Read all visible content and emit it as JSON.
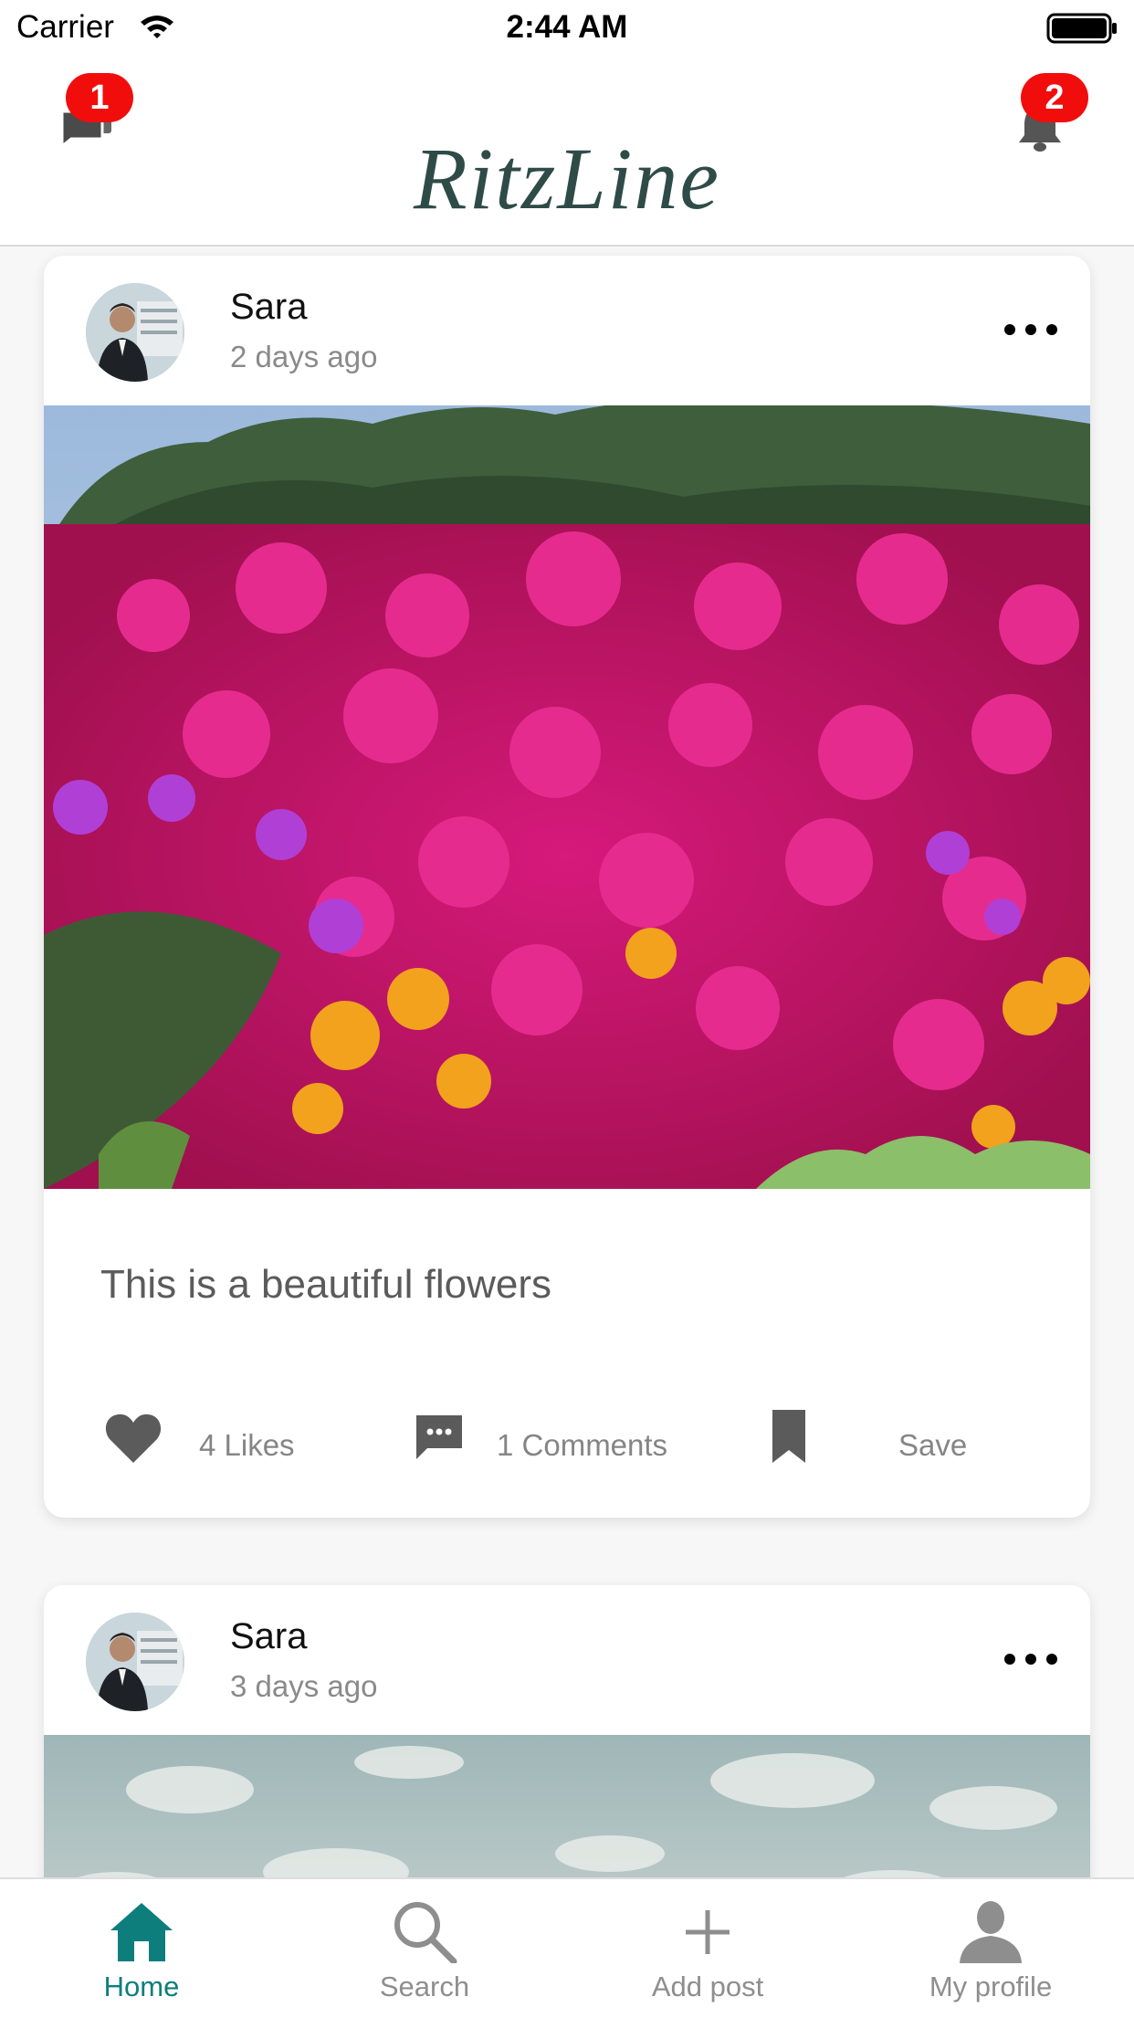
{
  "status_bar": {
    "carrier": "Carrier",
    "time": "2:44 AM"
  },
  "header": {
    "logo": "RitzLine",
    "messages_badge": "1",
    "notifications_badge": "2"
  },
  "posts": [
    {
      "author": "Sara",
      "time": "2 days ago",
      "caption": "This is a beautiful flowers",
      "likes_label": "4 Likes",
      "comments_label": "1 Comments",
      "save_label": "Save",
      "image": "flower-field-photo"
    },
    {
      "author": "Sara",
      "time": "3 days ago",
      "image": "cloudy-sky-photo"
    }
  ],
  "tabs": [
    {
      "label": "Home",
      "icon": "home-icon",
      "active": true
    },
    {
      "label": "Search",
      "icon": "search-icon"
    },
    {
      "label": "Add post",
      "icon": "plus-icon"
    },
    {
      "label": "My profile",
      "icon": "user-icon"
    }
  ],
  "colors": {
    "accent": "#0d7e7c",
    "badge": "#f20d0d",
    "logo": "#2f4b48"
  }
}
